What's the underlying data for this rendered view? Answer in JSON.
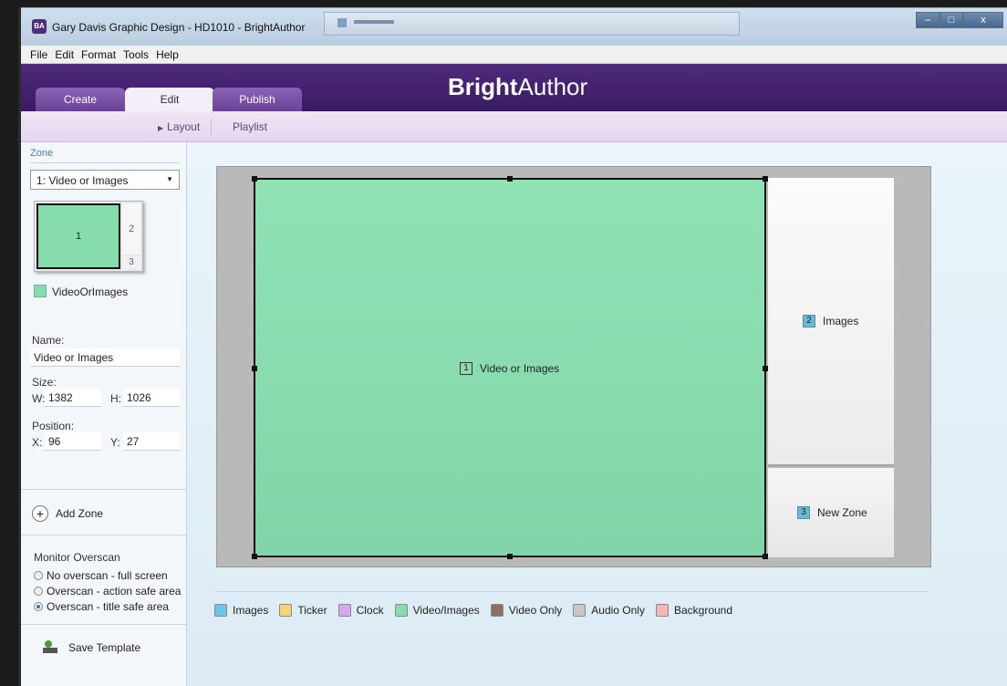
{
  "window": {
    "title": "Gary Davis Graphic Design - HD1010 - BrightAuthor",
    "app_icon_text": "BA",
    "controls": {
      "minimize": "–",
      "maximize": "□",
      "close": "x"
    }
  },
  "menu": [
    "File",
    "Edit",
    "Format",
    "Tools",
    "Help"
  ],
  "brand": {
    "bold": "Bright",
    "light": "Author"
  },
  "tabs": {
    "create": "Create",
    "edit": "Edit",
    "publish": "Publish",
    "active": "Edit"
  },
  "subnav": {
    "layout": "Layout",
    "playlist": "Playlist",
    "active": "Layout"
  },
  "sidebar": {
    "zone_section_label": "Zone",
    "zone_select_value": "1: Video or Images",
    "thumbnail_zones": [
      "1",
      "2",
      "3"
    ],
    "zone_type_label": "VideoOrImages",
    "name_label": "Name:",
    "name_value": "Video or Images",
    "size_label": "Size:",
    "w_label": "W:",
    "w_value": "1382",
    "h_label": "H:",
    "h_value": "1026",
    "position_label": "Position:",
    "x_label": "X:",
    "x_value": "96",
    "y_label": "Y:",
    "y_value": "27",
    "add_zone_label": "Add Zone",
    "overscan_title": "Monitor Overscan",
    "overscan_options": [
      {
        "label": "No overscan - full screen",
        "selected": false
      },
      {
        "label": "Overscan - action safe area",
        "selected": false
      },
      {
        "label": "Overscan - title safe area",
        "selected": true
      }
    ],
    "save_template_label": "Save Template"
  },
  "canvas": {
    "zones": [
      {
        "number": "1",
        "label": "Video or Images",
        "selected": true
      },
      {
        "number": "2",
        "label": "Images"
      },
      {
        "number": "3",
        "label": "New Zone"
      }
    ]
  },
  "legend": [
    {
      "label": "Images",
      "color": "#6ec6e6"
    },
    {
      "label": "Ticker",
      "color": "#f5d76e"
    },
    {
      "label": "Clock",
      "color": "#d3a8ec"
    },
    {
      "label": "Video/Images",
      "color": "#86dcac"
    },
    {
      "label": "Video Only",
      "color": "#8d6e63"
    },
    {
      "label": "Audio Only",
      "color": "#c8c8c8"
    },
    {
      "label": "Background",
      "color": "#f4b6b6"
    }
  ]
}
